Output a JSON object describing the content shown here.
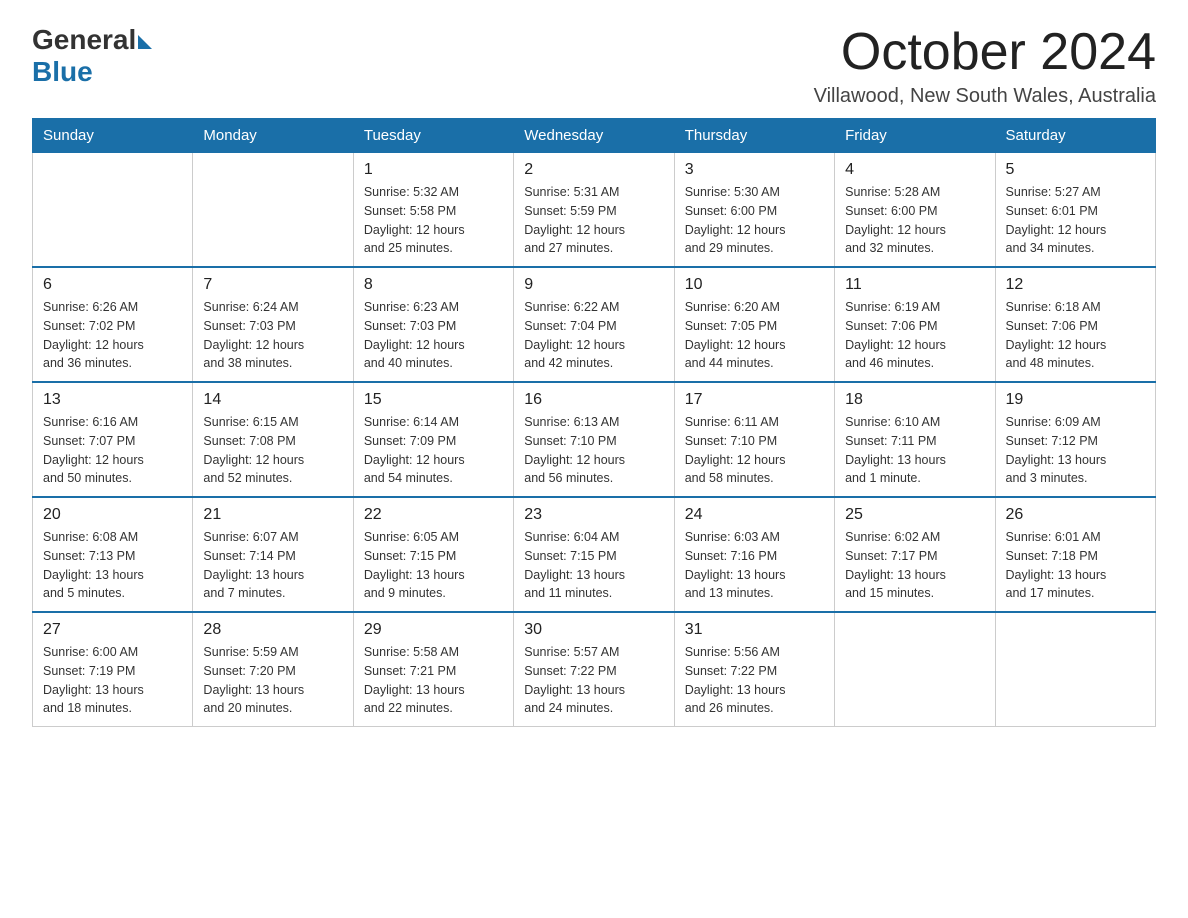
{
  "logo": {
    "general": "General",
    "blue": "Blue"
  },
  "title": "October 2024",
  "location": "Villawood, New South Wales, Australia",
  "days_header": [
    "Sunday",
    "Monday",
    "Tuesday",
    "Wednesday",
    "Thursday",
    "Friday",
    "Saturday"
  ],
  "weeks": [
    [
      {
        "day": "",
        "info": ""
      },
      {
        "day": "",
        "info": ""
      },
      {
        "day": "1",
        "info": "Sunrise: 5:32 AM\nSunset: 5:58 PM\nDaylight: 12 hours\nand 25 minutes."
      },
      {
        "day": "2",
        "info": "Sunrise: 5:31 AM\nSunset: 5:59 PM\nDaylight: 12 hours\nand 27 minutes."
      },
      {
        "day": "3",
        "info": "Sunrise: 5:30 AM\nSunset: 6:00 PM\nDaylight: 12 hours\nand 29 minutes."
      },
      {
        "day": "4",
        "info": "Sunrise: 5:28 AM\nSunset: 6:00 PM\nDaylight: 12 hours\nand 32 minutes."
      },
      {
        "day": "5",
        "info": "Sunrise: 5:27 AM\nSunset: 6:01 PM\nDaylight: 12 hours\nand 34 minutes."
      }
    ],
    [
      {
        "day": "6",
        "info": "Sunrise: 6:26 AM\nSunset: 7:02 PM\nDaylight: 12 hours\nand 36 minutes."
      },
      {
        "day": "7",
        "info": "Sunrise: 6:24 AM\nSunset: 7:03 PM\nDaylight: 12 hours\nand 38 minutes."
      },
      {
        "day": "8",
        "info": "Sunrise: 6:23 AM\nSunset: 7:03 PM\nDaylight: 12 hours\nand 40 minutes."
      },
      {
        "day": "9",
        "info": "Sunrise: 6:22 AM\nSunset: 7:04 PM\nDaylight: 12 hours\nand 42 minutes."
      },
      {
        "day": "10",
        "info": "Sunrise: 6:20 AM\nSunset: 7:05 PM\nDaylight: 12 hours\nand 44 minutes."
      },
      {
        "day": "11",
        "info": "Sunrise: 6:19 AM\nSunset: 7:06 PM\nDaylight: 12 hours\nand 46 minutes."
      },
      {
        "day": "12",
        "info": "Sunrise: 6:18 AM\nSunset: 7:06 PM\nDaylight: 12 hours\nand 48 minutes."
      }
    ],
    [
      {
        "day": "13",
        "info": "Sunrise: 6:16 AM\nSunset: 7:07 PM\nDaylight: 12 hours\nand 50 minutes."
      },
      {
        "day": "14",
        "info": "Sunrise: 6:15 AM\nSunset: 7:08 PM\nDaylight: 12 hours\nand 52 minutes."
      },
      {
        "day": "15",
        "info": "Sunrise: 6:14 AM\nSunset: 7:09 PM\nDaylight: 12 hours\nand 54 minutes."
      },
      {
        "day": "16",
        "info": "Sunrise: 6:13 AM\nSunset: 7:10 PM\nDaylight: 12 hours\nand 56 minutes."
      },
      {
        "day": "17",
        "info": "Sunrise: 6:11 AM\nSunset: 7:10 PM\nDaylight: 12 hours\nand 58 minutes."
      },
      {
        "day": "18",
        "info": "Sunrise: 6:10 AM\nSunset: 7:11 PM\nDaylight: 13 hours\nand 1 minute."
      },
      {
        "day": "19",
        "info": "Sunrise: 6:09 AM\nSunset: 7:12 PM\nDaylight: 13 hours\nand 3 minutes."
      }
    ],
    [
      {
        "day": "20",
        "info": "Sunrise: 6:08 AM\nSunset: 7:13 PM\nDaylight: 13 hours\nand 5 minutes."
      },
      {
        "day": "21",
        "info": "Sunrise: 6:07 AM\nSunset: 7:14 PM\nDaylight: 13 hours\nand 7 minutes."
      },
      {
        "day": "22",
        "info": "Sunrise: 6:05 AM\nSunset: 7:15 PM\nDaylight: 13 hours\nand 9 minutes."
      },
      {
        "day": "23",
        "info": "Sunrise: 6:04 AM\nSunset: 7:15 PM\nDaylight: 13 hours\nand 11 minutes."
      },
      {
        "day": "24",
        "info": "Sunrise: 6:03 AM\nSunset: 7:16 PM\nDaylight: 13 hours\nand 13 minutes."
      },
      {
        "day": "25",
        "info": "Sunrise: 6:02 AM\nSunset: 7:17 PM\nDaylight: 13 hours\nand 15 minutes."
      },
      {
        "day": "26",
        "info": "Sunrise: 6:01 AM\nSunset: 7:18 PM\nDaylight: 13 hours\nand 17 minutes."
      }
    ],
    [
      {
        "day": "27",
        "info": "Sunrise: 6:00 AM\nSunset: 7:19 PM\nDaylight: 13 hours\nand 18 minutes."
      },
      {
        "day": "28",
        "info": "Sunrise: 5:59 AM\nSunset: 7:20 PM\nDaylight: 13 hours\nand 20 minutes."
      },
      {
        "day": "29",
        "info": "Sunrise: 5:58 AM\nSunset: 7:21 PM\nDaylight: 13 hours\nand 22 minutes."
      },
      {
        "day": "30",
        "info": "Sunrise: 5:57 AM\nSunset: 7:22 PM\nDaylight: 13 hours\nand 24 minutes."
      },
      {
        "day": "31",
        "info": "Sunrise: 5:56 AM\nSunset: 7:22 PM\nDaylight: 13 hours\nand 26 minutes."
      },
      {
        "day": "",
        "info": ""
      },
      {
        "day": "",
        "info": ""
      }
    ]
  ]
}
